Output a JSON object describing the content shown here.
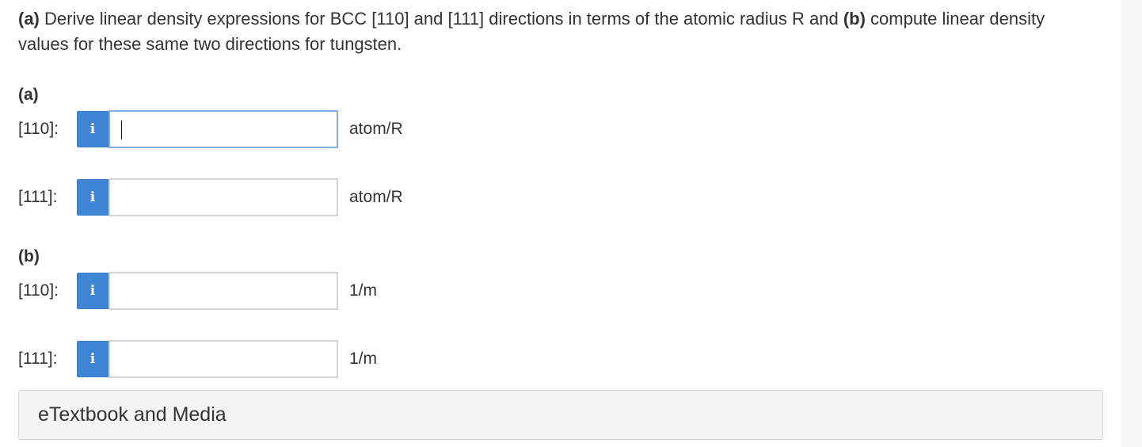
{
  "question": {
    "part_a_marker": "(a)",
    "text_1": " Derive linear density expressions for BCC [110] and [111] directions in terms of the atomic radius R and ",
    "part_b_marker": "(b)",
    "text_2": " compute linear density values for these same two directions for tungsten."
  },
  "part_a": {
    "label": "(a)",
    "rows": [
      {
        "label": "[110]:",
        "info_icon": "i",
        "value": "",
        "unit": "atom/R"
      },
      {
        "label": "[111]:",
        "info_icon": "i",
        "value": "",
        "unit": "atom/R"
      }
    ]
  },
  "part_b": {
    "label": "(b)",
    "rows": [
      {
        "label": "[110]:",
        "info_icon": "i",
        "value": "",
        "unit": "1/m"
      },
      {
        "label": "[111]:",
        "info_icon": "i",
        "value": "",
        "unit": "1/m"
      }
    ]
  },
  "etextbook": {
    "label": "eTextbook and Media"
  },
  "colors": {
    "info_button": "#3f85d5",
    "focused_border": "#7fb1e8",
    "input_border": "#d4d4d4",
    "panel_bg": "#f4f4f4"
  }
}
